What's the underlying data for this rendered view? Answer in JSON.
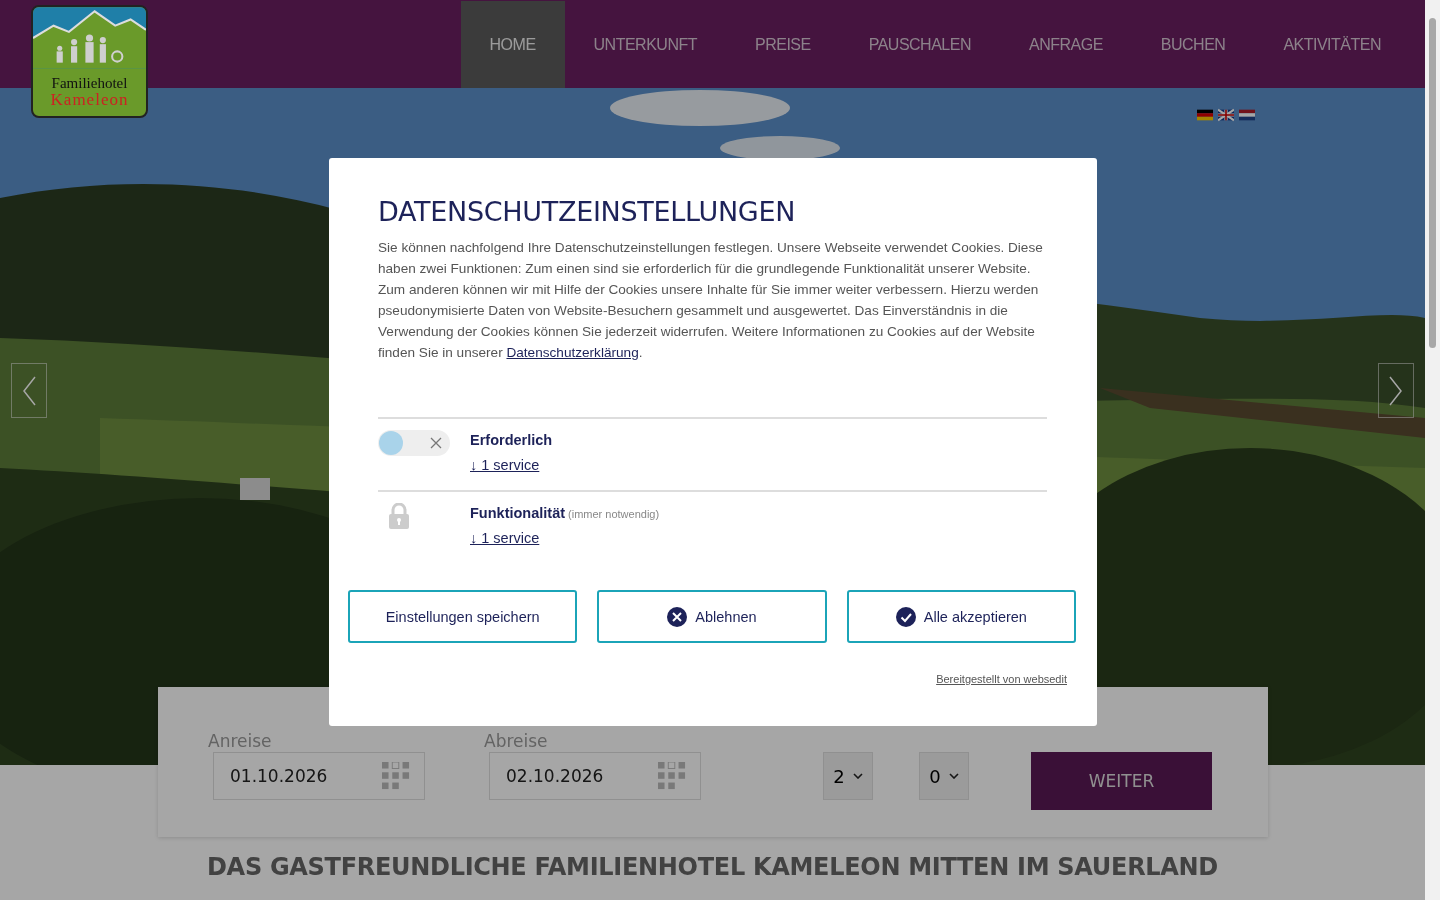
{
  "logo": {
    "line1": "Familiehotel",
    "line2": "Kameleon"
  },
  "nav": [
    {
      "label": "HOME",
      "selected": true
    },
    {
      "label": "UNTERKUNFT",
      "selected": false
    },
    {
      "label": "PREISE",
      "selected": false
    },
    {
      "label": "PAUSCHALEN",
      "selected": false
    },
    {
      "label": "ANFRAGE",
      "selected": false
    },
    {
      "label": "BUCHEN",
      "selected": false
    },
    {
      "label": "AKTIVITÄTEN",
      "selected": false
    }
  ],
  "booking": {
    "arrival_label": "Anreise",
    "arrival": "01.10.2026",
    "departure_label": "Abreise",
    "departure": "02.10.2026",
    "adults": "2",
    "children": "0",
    "button": "WEITER"
  },
  "headline": "DAS GASTFREUNDLICHE FAMILIENHOTEL KAMELEON MITTEN IM SAUERLAND",
  "dialog": {
    "title": "DATENSCHUTZEINSTELLUNGEN",
    "text": "Sie können nachfolgend Ihre Datenschutzeinstellungen festlegen. Unsere Webseite verwendet Cookies. Diese haben zwei Funktionen: Zum einen sind sie erforderlich für die grundlegende Funktionalität unserer Website. Zum anderen können wir mit Hilfe der Cookies unsere Inhalte für Sie immer weiter verbessern. Hierzu werden pseudonymisierte Daten von Website-Besuchern gesammelt und ausgewertet. Das Einverständnis in die Verwendung der Cookies können Sie jederzeit widerrufen. Weitere Informationen zu Cookies auf der Website finden Sie in unserer",
    "link": "Datenschutzerklärung",
    "after": ".",
    "categories": [
      {
        "kind": "toggle",
        "on": false,
        "name": "Erforderlich",
        "services": "↓ 1 service"
      },
      {
        "kind": "locked",
        "name": "Funktionalität",
        "note": "(immer notwendig)",
        "services": "↓ 1 service"
      }
    ],
    "buttons": [
      {
        "kind": "plain",
        "label": "Einstellungen speichern"
      },
      {
        "kind": "decline",
        "label": "Ablehnen"
      },
      {
        "kind": "accept",
        "label": "Alle akzeptieren"
      }
    ],
    "credit": "Bereitgestellt von websedit"
  }
}
